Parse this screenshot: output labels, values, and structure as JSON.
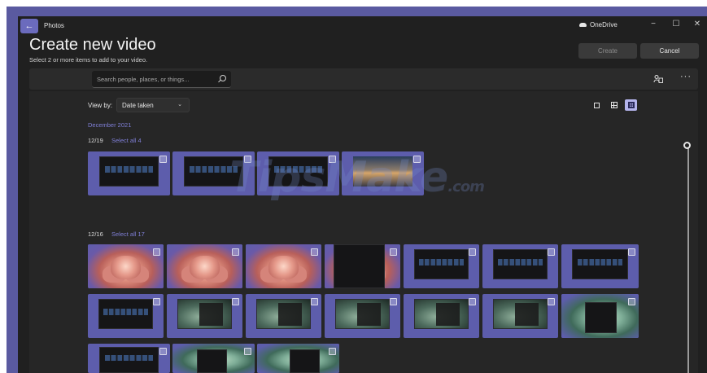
{
  "app": {
    "back_glyph": "←",
    "title": "Photos"
  },
  "onedrive_label": "OneDrive",
  "window_controls": {
    "minimize": "−",
    "maximize": "☐",
    "close": "✕"
  },
  "header": {
    "title": "Create new video",
    "subtitle": "Select 2 or more items to add to your video."
  },
  "actions": {
    "create_label": "Create",
    "cancel_label": "Cancel"
  },
  "search": {
    "placeholder": "Search people, places, or things..."
  },
  "toolbar": {
    "people_icon": "people-icon",
    "more_glyph": "···"
  },
  "view_by": {
    "label": "View by:",
    "value": "Date taken"
  },
  "view_modes": [
    "single",
    "grid",
    "fine-grid"
  ],
  "active_view_mode": "fine-grid",
  "month_label": "December 2021",
  "groups": [
    {
      "date": "12/19",
      "select_all": "Select all 4"
    },
    {
      "date": "12/16",
      "select_all": "Select all 17"
    }
  ],
  "watermark": {
    "main": "TipsMake",
    "suffix": ".com"
  },
  "colors": {
    "accent": "#6b6bbd",
    "link": "#7f7fd6",
    "background": "#202020",
    "tile": "#5d5dac"
  }
}
